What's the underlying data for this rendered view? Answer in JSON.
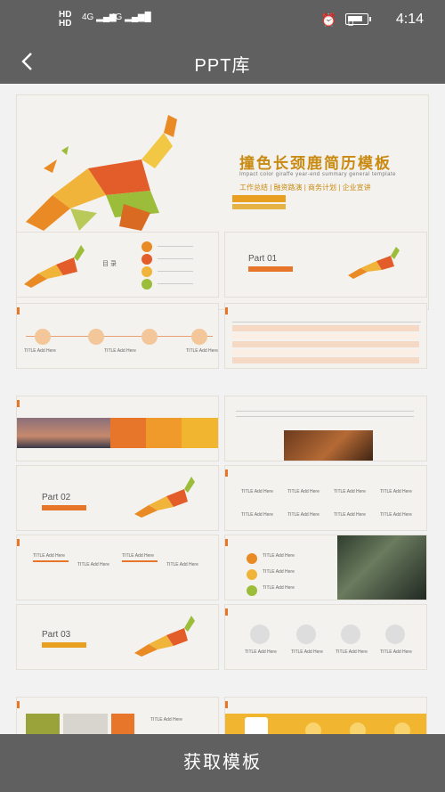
{
  "status": {
    "hd1": "HD",
    "hd2": "HD",
    "sig1": "4G",
    "sig2": "4G",
    "time": "4:14"
  },
  "nav": {
    "title": "PPT库"
  },
  "hero": {
    "title": "撞色长颈鹿简历模板",
    "subtitle": "Impact color giraffe year-end summary general template",
    "tags": "工作总结 | 融资路演 | 商务计划 | 企业宣讲"
  },
  "slides": {
    "toc_title": "目 录",
    "part01": "Part 01",
    "part02": "Part 02",
    "part03": "Part 03",
    "item_title": "TITLE Add Here"
  },
  "action": {
    "label": "获取模板"
  }
}
